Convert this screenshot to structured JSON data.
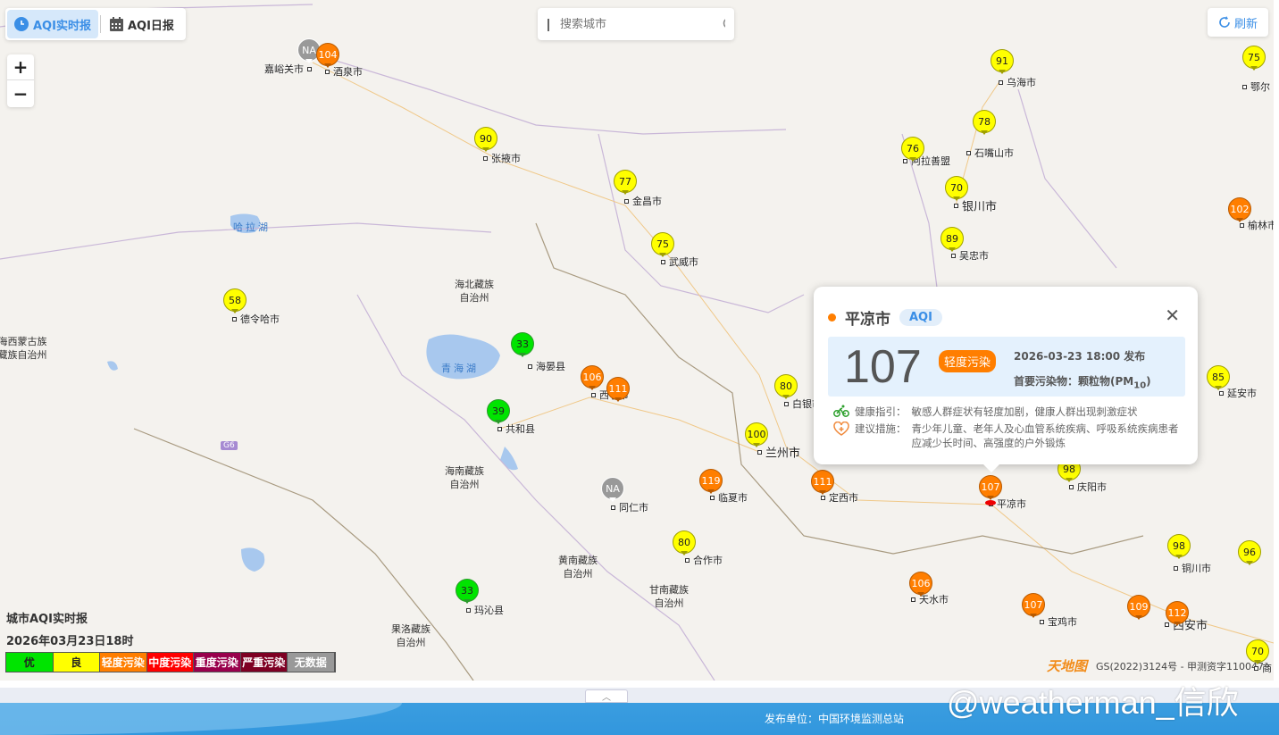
{
  "toolbar": {
    "realtime_tab": "AQI实时报",
    "daily_tab": "AQI日报",
    "search_placeholder": "搜索城市",
    "refresh": "刷新",
    "zoom_in": "+",
    "zoom_out": "−"
  },
  "colors": {
    "excellent": "#00e400",
    "good": "#ffff00",
    "light": "#ff7e00",
    "moderate": "#ff0000",
    "heavy": "#99004c",
    "severe": "#7e0023",
    "nodata": "#999999",
    "accent": "#3a8ee6"
  },
  "markers": [
    {
      "city": "嘉峪关市",
      "value": "NA",
      "level": "nodata"
    },
    {
      "city": "酒泉市",
      "value": "104",
      "level": "light"
    },
    {
      "city": "张掖市",
      "value": "90",
      "level": "good"
    },
    {
      "city": "金昌市",
      "value": "77",
      "level": "good"
    },
    {
      "city": "武威市",
      "value": "75",
      "level": "good"
    },
    {
      "city": "德令哈市",
      "value": "58",
      "level": "good"
    },
    {
      "city": "海晏县",
      "value": "33",
      "level": "excellent"
    },
    {
      "city": "西宁市",
      "value": "106",
      "level": "light"
    },
    {
      "city": "",
      "value": "111",
      "level": "light"
    },
    {
      "city": "共和县",
      "value": "39",
      "level": "excellent"
    },
    {
      "city": "同仁市",
      "value": "NA",
      "level": "nodata"
    },
    {
      "city": "临夏市",
      "value": "119",
      "level": "light"
    },
    {
      "city": "定西市",
      "value": "111",
      "level": "light"
    },
    {
      "city": "兰州市",
      "value": "100",
      "level": "good"
    },
    {
      "city": "白银市",
      "value": "80",
      "level": "good"
    },
    {
      "city": "合作市",
      "value": "80",
      "level": "good"
    },
    {
      "city": "玛沁县",
      "value": "33",
      "level": "excellent"
    },
    {
      "city": "天水市",
      "value": "106",
      "level": "light"
    },
    {
      "city": "宝鸡市",
      "value": "107",
      "level": "light"
    },
    {
      "city": "",
      "value": "109",
      "level": "light"
    },
    {
      "city": "西安市",
      "value": "112",
      "level": "light"
    },
    {
      "city": "铜川市",
      "value": "98",
      "level": "good"
    },
    {
      "city": "",
      "value": "96",
      "level": "good"
    },
    {
      "city": "商",
      "value": "70",
      "level": "good"
    },
    {
      "city": "平凉市",
      "value": "107",
      "level": "light"
    },
    {
      "city": "庆阳市",
      "value": "98",
      "level": "good"
    },
    {
      "city": "延安市",
      "value": "85",
      "level": "good"
    },
    {
      "city": "榆林市",
      "value": "102",
      "level": "light"
    },
    {
      "city": "鄂尔",
      "value": "75",
      "level": "good"
    },
    {
      "city": "乌海市",
      "value": "91",
      "level": "good"
    },
    {
      "city": "石嘴山市",
      "value": "78",
      "level": "good"
    },
    {
      "city": "阿拉善盟",
      "value": "76",
      "level": "good"
    },
    {
      "city": "银川市",
      "value": "70",
      "level": "good"
    },
    {
      "city": "吴忠市",
      "value": "89",
      "level": "good"
    }
  ],
  "regions": [
    "海北藏族\n自治州",
    "海南藏族\n自治州",
    "黄南藏族\n自治州",
    "甘南藏族\n自治州",
    "果洛藏族\n自治州",
    "海西蒙古族\n藏族自治州"
  ],
  "lakes": [
    "哈拉湖",
    "青海湖"
  ],
  "road_badge": "G6",
  "popup": {
    "city": "平凉市",
    "badge": "AQI",
    "aqi": "107",
    "level": "轻度污染",
    "time": "2026-03-23 18:00 发布",
    "pollutant_prefix": "首要污染物：颗粒物(PM",
    "pollutant_sub": "10",
    "pollutant_suffix": ")",
    "health_label": "健康指引：",
    "health": "敏感人群症状有轻度加剧，健康人群出现刺激症状",
    "advice_label": "建议措施：",
    "advice": "青少年儿童、老年人及心血管系统疾病、呼吸系统疾病患者应减少长时间、高强度的户外锻炼"
  },
  "legend": {
    "title": "城市AQI实时报",
    "time": "2026年03月23日18时",
    "items": [
      "优",
      "良",
      "轻度污染",
      "中度污染",
      "重度污染",
      "严重污染",
      "无数据"
    ]
  },
  "map_credit": "GS(2022)3124号 - 甲测资字1100471",
  "map_logo": "天地图",
  "footer": {
    "publisher": "发布单位：中国环境监测总站",
    "watermark": "@weatherman_信欣"
  }
}
